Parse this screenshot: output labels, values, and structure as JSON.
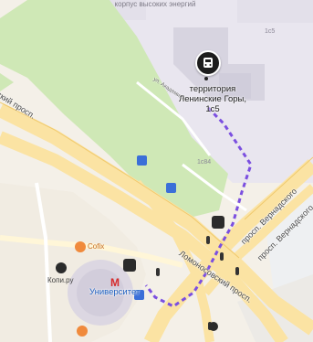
{
  "map": {
    "top_label": "корпус высоких энергий",
    "building_number_1": "1с5",
    "building_number_2": "1с84",
    "street_small": "ул. Академика",
    "selected_place": {
      "name": "территория Ленинские Горы, 1с5",
      "icon": "building-pin-icon"
    },
    "road_labels": {
      "lomonosovsky_top": "ский просп.",
      "lomonosovsky_bottom": "Ломоносовский просп.",
      "vernadsky_1": "просп. Вернадского",
      "vernadsky_2": "просп. Вернадского"
    },
    "pois": {
      "cofix": "Cofix",
      "kopi": "Копи.ру"
    },
    "metro": {
      "name": "Университет",
      "icon": "metro-icon",
      "color": "#d62b2b"
    },
    "route_color": "#7b4fe0",
    "park_color": "#cfe8b6",
    "road_color": "#fbe3a3"
  }
}
